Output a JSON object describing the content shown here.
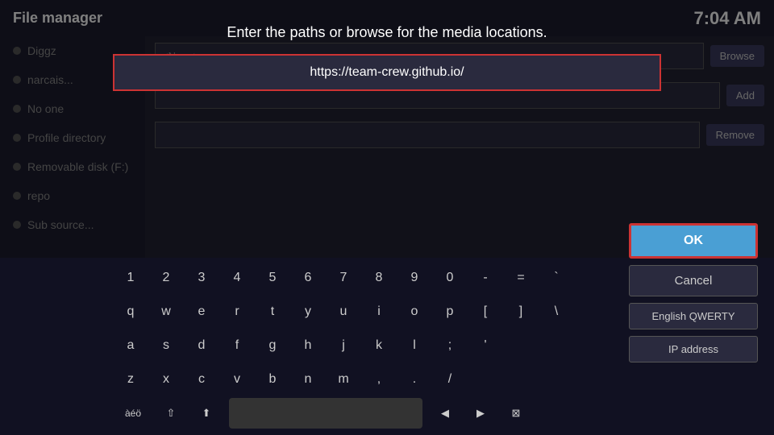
{
  "topbar": {
    "title": "File manager",
    "time": "7:04 AM"
  },
  "sidebar": {
    "items": [
      {
        "label": "Diggz"
      },
      {
        "label": "narcais..."
      },
      {
        "label": "No one"
      },
      {
        "label": "Profile directory"
      },
      {
        "label": "Removable disk (F:)"
      },
      {
        "label": "repo"
      },
      {
        "label": "Sub source..."
      }
    ]
  },
  "content_rows": [
    {
      "col1": "<None>",
      "col2": "",
      "col3": "Browse"
    },
    {
      "col1": "",
      "col2": "",
      "col3": "Add"
    },
    {
      "col1": "",
      "col2": "",
      "col3": "Remove"
    }
  ],
  "dialog": {
    "prompt": "Enter the paths or browse for the media locations.",
    "url_value": "https://team-crew.github.io/",
    "url_placeholder": "https://team-crew.github.io/"
  },
  "keyboard": {
    "row1": [
      "1",
      "2",
      "3",
      "4",
      "5",
      "6",
      "7",
      "8",
      "9",
      "0",
      "-",
      "=",
      "`"
    ],
    "row2": [
      "q",
      "w",
      "e",
      "r",
      "t",
      "y",
      "u",
      "i",
      "o",
      "p",
      "[",
      "]",
      "\\"
    ],
    "row3": [
      "a",
      "s",
      "d",
      "f",
      "g",
      "h",
      "j",
      "k",
      "l",
      ";",
      "'"
    ],
    "row4": [
      "z",
      "x",
      "c",
      "v",
      "b",
      "n",
      "m",
      ",",
      " .",
      "/"
    ],
    "special_left": "àéö",
    "special_shift_icon": "⇧",
    "special_caps_icon": "⬆",
    "special_backspace_icon": "⌫"
  },
  "buttons": {
    "ok_label": "OK",
    "cancel_label": "Cancel",
    "layout_label": "English QWERTY",
    "ip_label": "IP address"
  }
}
